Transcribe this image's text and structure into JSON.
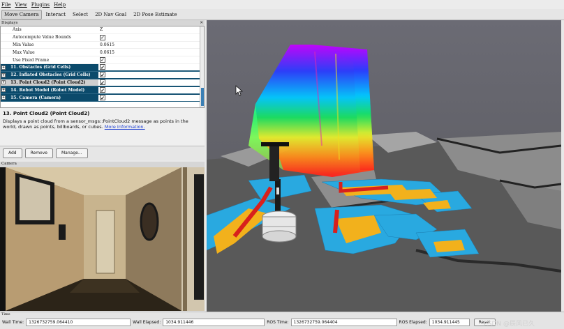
{
  "menu": [
    "File",
    "View",
    "Plugins",
    "Help"
  ],
  "toolbar": [
    "Move Camera",
    "Interact",
    "Select",
    "2D Nav Goal",
    "2D Pose Estimate"
  ],
  "displays": {
    "title": "Displays",
    "close_glyph": "✕",
    "properties": [
      {
        "name": "Axis",
        "value": "Z"
      },
      {
        "name": "Autocompute Value Bounds",
        "value": "✓"
      },
      {
        "name": "Min Value",
        "value": "0.0615"
      },
      {
        "name": "Max Value",
        "value": "0.0615"
      },
      {
        "name": "Use Fixed Frame",
        "value": "✓"
      }
    ],
    "groups": [
      {
        "label": "11. Obstacles (Grid Cells)",
        "checked": "✓"
      },
      {
        "label": "12. Inflated Obstacles (Grid Cells)",
        "checked": "✓"
      },
      {
        "label": "13. Point Cloud2 (Point Cloud2)",
        "checked": "✓"
      },
      {
        "label": "14. Robot Model (Robot Model)",
        "checked": "✓"
      },
      {
        "label": "15. Camera (Camera)",
        "checked": "✓"
      }
    ]
  },
  "description": {
    "title": "13. Point Cloud2 (Point Cloud2)",
    "text": "Displays a point cloud from a sensor_msgs::PointCloud2 message as points in the world, drawn as points, billboards, or cubes.",
    "link": "More Information."
  },
  "buttons": {
    "add": "Add",
    "remove": "Remove",
    "manage": "Manage..."
  },
  "camera": {
    "title": "Camera"
  },
  "time": {
    "title": "Time",
    "wall_time_label": "Wall Time:",
    "wall_time": "1326732759.064410",
    "wall_elapsed_label": "Wall Elapsed:",
    "wall_elapsed": "1034.911446",
    "ros_time_label": "ROS Time:",
    "ros_time": "1326732759.064404",
    "ros_elapsed_label": "ROS Elapsed:",
    "ros_elapsed": "1034.911445",
    "reset": "Reset"
  },
  "watermark": "CSDN @辰风已久",
  "colors": {
    "group_bg": "#0b4a6b",
    "link": "#1a3cd0",
    "grid_cyan": "#29a9e0",
    "grid_orange": "#f2b11c",
    "grid_red": "#d8201c"
  }
}
